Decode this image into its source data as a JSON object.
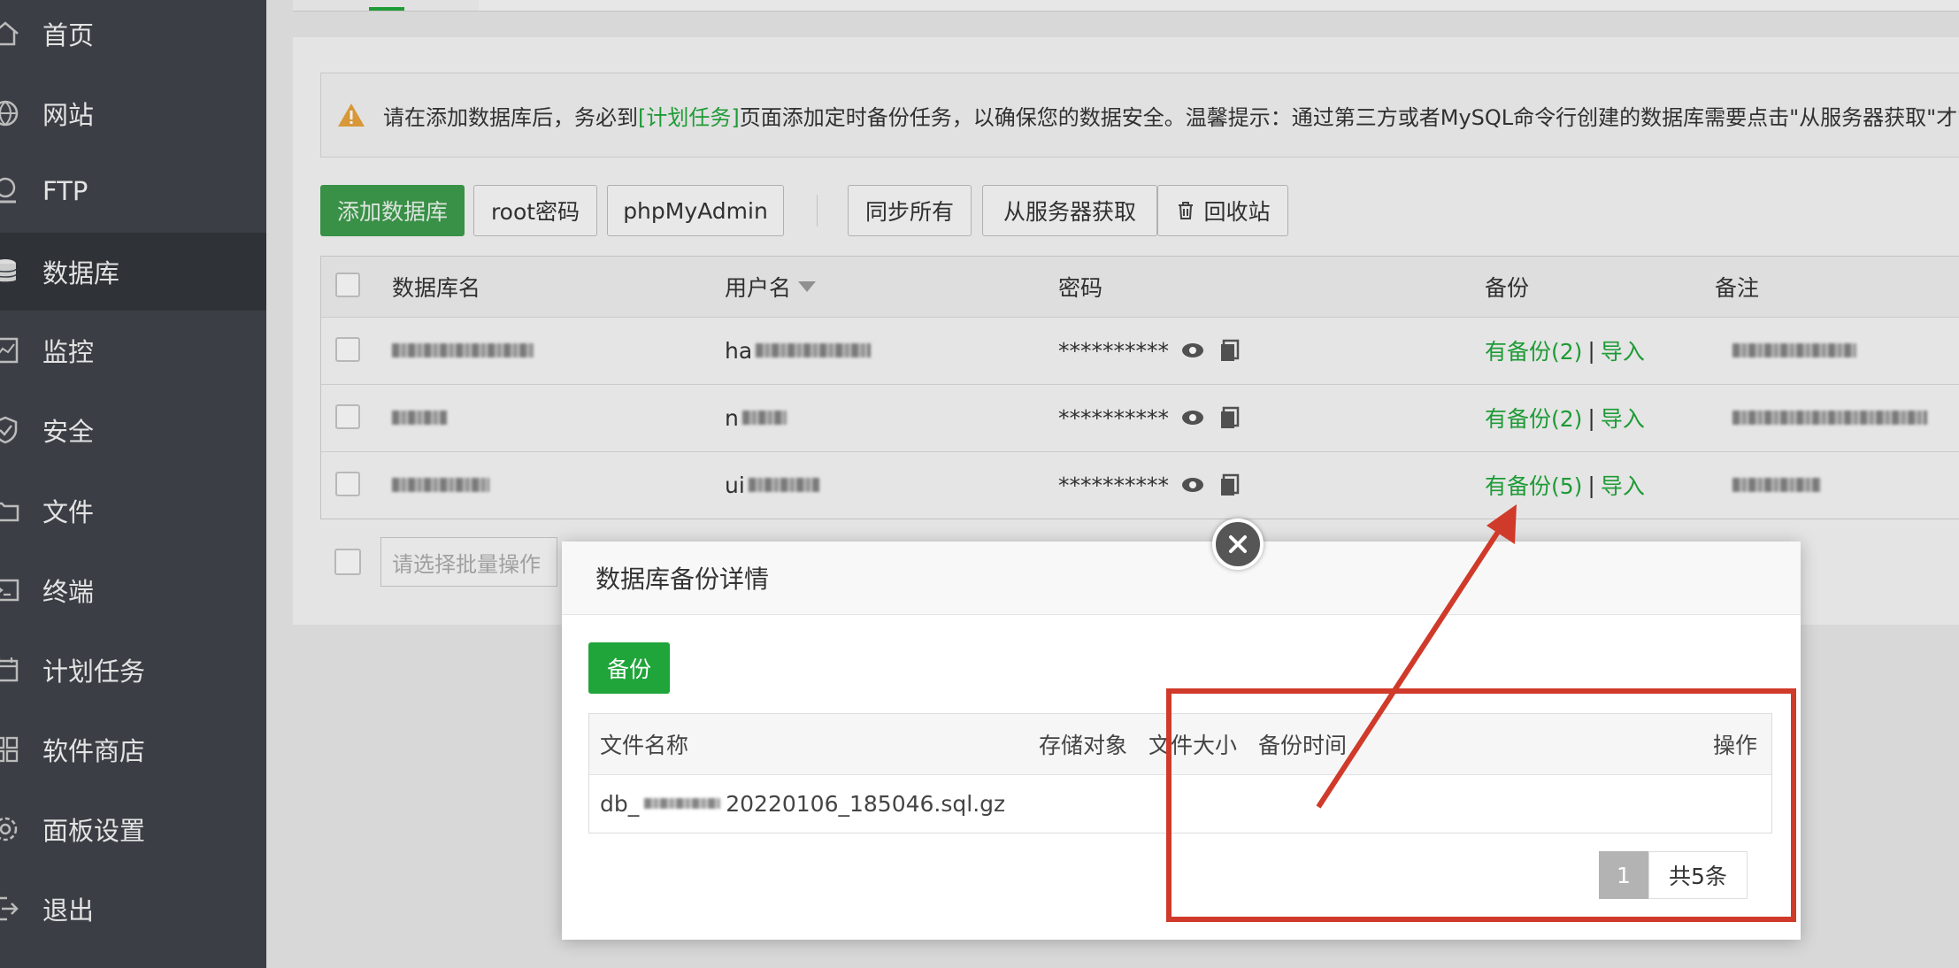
{
  "sidebar": {
    "items": [
      {
        "label": "首页",
        "icon": "home-icon"
      },
      {
        "label": "网站",
        "icon": "globe-icon"
      },
      {
        "label": "FTP",
        "icon": "ftp-icon"
      },
      {
        "label": "数据库",
        "icon": "database-icon",
        "active": true
      },
      {
        "label": "监控",
        "icon": "monitor-icon"
      },
      {
        "label": "安全",
        "icon": "shield-icon"
      },
      {
        "label": "文件",
        "icon": "folder-icon"
      },
      {
        "label": "终端",
        "icon": "terminal-icon"
      },
      {
        "label": "计划任务",
        "icon": "calendar-icon"
      },
      {
        "label": "软件商店",
        "icon": "grid-icon"
      },
      {
        "label": "面板设置",
        "icon": "gear-icon"
      },
      {
        "label": "退出",
        "icon": "logout-icon"
      }
    ]
  },
  "notice": {
    "pre": "请在添加数据库后，务必到",
    "link": "[计划任务]",
    "post": "页面添加定时备份任务，以确保您的数据安全。温馨提示：通过第三方或者MySQL命令行创建的数据库需要点击\"从服务器获取\"才能"
  },
  "toolbar": {
    "add_db": "添加数据库",
    "root_pwd": "root密码",
    "phpmyadmin": "phpMyAdmin",
    "sync_all": "同步所有",
    "fetch_server": "从服务器获取",
    "recycle": "回收站"
  },
  "table": {
    "headers": {
      "name": "数据库名",
      "user": "用户名",
      "password": "密码",
      "backup": "备份",
      "note": "备注"
    },
    "rows": [
      {
        "user_prefix": "ha",
        "password": "**********",
        "backup": "有备份(2)",
        "sep": "|",
        "import": "导入"
      },
      {
        "user_prefix": "n",
        "password": "**********",
        "backup": "有备份(2)",
        "sep": "|",
        "import": "导入"
      },
      {
        "user_prefix": "ui",
        "password": "**********",
        "backup": "有备份(5)",
        "sep": "|",
        "import": "导入"
      }
    ]
  },
  "batch": {
    "placeholder": "请选择批量操作"
  },
  "modal": {
    "title": "数据库备份详情",
    "backup_button": "备份",
    "headers": {
      "filename": "文件名称",
      "storage": "存储对象",
      "size": "文件大小",
      "time": "备份时间",
      "action": "操作"
    },
    "rows": [
      {
        "filename_prefix": "db_",
        "filename_suffix": "20220106_185046.sql.gz"
      }
    ],
    "pager": {
      "current": "1",
      "total": "共5条"
    }
  },
  "colors": {
    "accent": "#20a53a",
    "annotation": "#d03a2a",
    "sidebar": "#3b3f45"
  }
}
